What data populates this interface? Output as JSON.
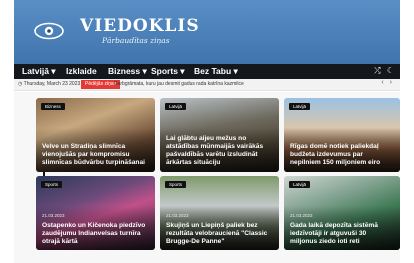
{
  "brand": {
    "title": "VIEDOKLIS",
    "subtitle": "Pārbaudītas ziņas"
  },
  "nav": {
    "items": [
      "Latvijā",
      "Izklaide",
      "Bizness",
      "Sports",
      "Bez Tabu"
    ],
    "dropdown_flags": [
      true,
      false,
      true,
      true,
      true
    ],
    "icons": [
      "shuffle-icon",
      "moon-icon"
    ]
  },
  "ticker": {
    "date": "Thursday, March 23 2023",
    "label": "Pēdējās ziņas",
    "text": "Darbgrāmata, kuru jau desmit gadus rada katrīna kazmilce"
  },
  "cards": [
    {
      "badge": "Bizness",
      "date": "",
      "title": "Velve un Stradiņa slimnīca vienojušās par kompromisu slimnīcas būdvārbu turpināšanai"
    },
    {
      "badge": "Latvijā",
      "date": "",
      "title": "Lai glābtu aijeu mežus no atstādības mūnmaijās vairākās pašvaldībās varētu izsludināt ārkārtas situāciju"
    },
    {
      "badge": "Latvijā",
      "date": "",
      "title": "Rīgas domē notiek paliekdaļ budžeta izdevumus par nepilniem 150 miljoniem eiro"
    },
    {
      "badge": "Sports",
      "date": "21.03.2023",
      "title": "Ostapenko un Kičenoka piedzīvo zaudējumu Indianvelsas turnīra otrajā kārtā"
    },
    {
      "badge": "Sports",
      "date": "21.03.2023",
      "title": "Skujiņš un Liepiņš paliek bez rezultāta velobraucienā \"Classic Brugge-De Panne\""
    },
    {
      "badge": "Latvijā",
      "date": "21.03.2023",
      "title": "Gada laikā depozīta sistēmā iedzīvotāji ir atguvuši 30 miljonus ziedo ioti reti"
    }
  ],
  "colors": {
    "header": "#4a7fb8",
    "nav": "#14171c",
    "accent": "#e53935"
  }
}
